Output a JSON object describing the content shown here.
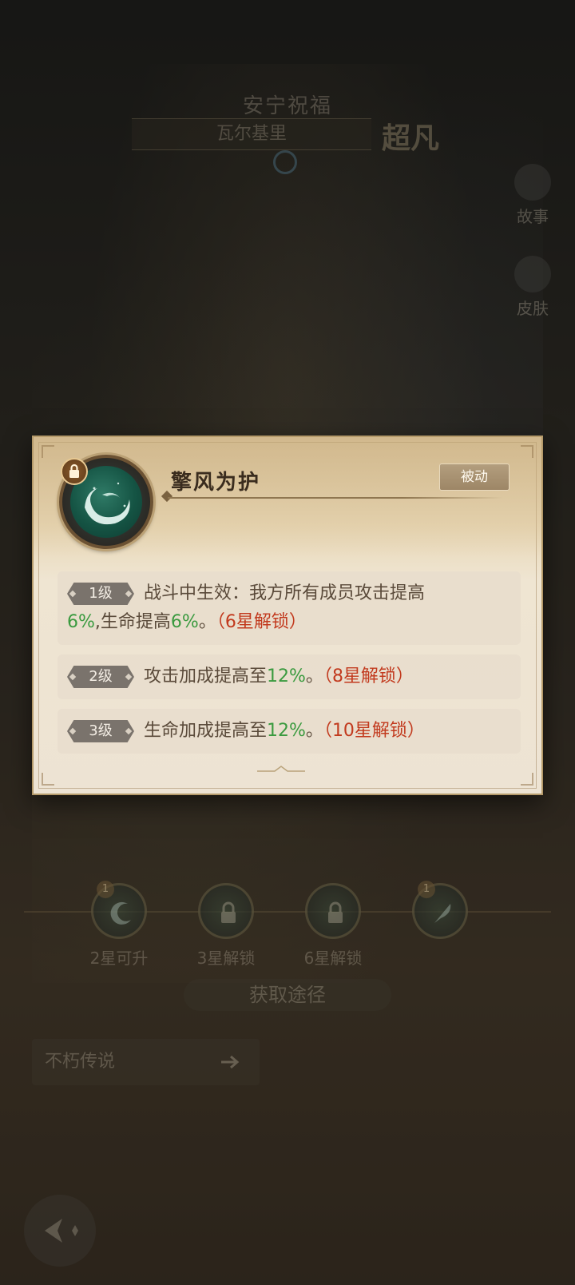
{
  "background": {
    "hero_title": "安宁祝福",
    "hero_name": "瓦尔基里",
    "rarity": "超凡",
    "side_buttons": [
      {
        "label": "故事",
        "icon": "book-icon"
      },
      {
        "label": "皮肤",
        "icon": "skin-icon"
      }
    ],
    "skill_slots": [
      {
        "badge": "1",
        "label": "2星可升",
        "icon": "moon-swirl-icon",
        "locked": false
      },
      {
        "badge": "",
        "label": "3星解锁",
        "icon": "lock-icon",
        "locked": true
      },
      {
        "badge": "",
        "label": "6星解锁",
        "icon": "lock-icon",
        "locked": true
      },
      {
        "badge": "1",
        "label": "",
        "icon": "feather-icon",
        "locked": false
      }
    ],
    "source_title": "获取途径",
    "source_item": "不朽传说"
  },
  "card": {
    "skill_name": "擎风为护",
    "type_tag": "被动",
    "levels": [
      {
        "level": "1级",
        "parts": {
          "a": "战斗中生效：我方所有成员攻击提高",
          "b": "6%",
          "c": ",生命提高",
          "d": "6%",
          "e": "。",
          "f": "（6星解锁）"
        }
      },
      {
        "level": "2级",
        "parts": {
          "a": "攻击加成提高至",
          "b": "12%",
          "c": "。",
          "d": "（8星解锁）"
        }
      },
      {
        "level": "3级",
        "parts": {
          "a": "生命加成提高至",
          "b": "12%",
          "c": "。",
          "d": "（10星解锁）"
        }
      }
    ]
  },
  "colors": {
    "highlight_green": "#3a9a3f",
    "unlock_red": "#c23a1e",
    "card_bg": "#ede3d3",
    "tag_bg": "#a68f6e"
  }
}
